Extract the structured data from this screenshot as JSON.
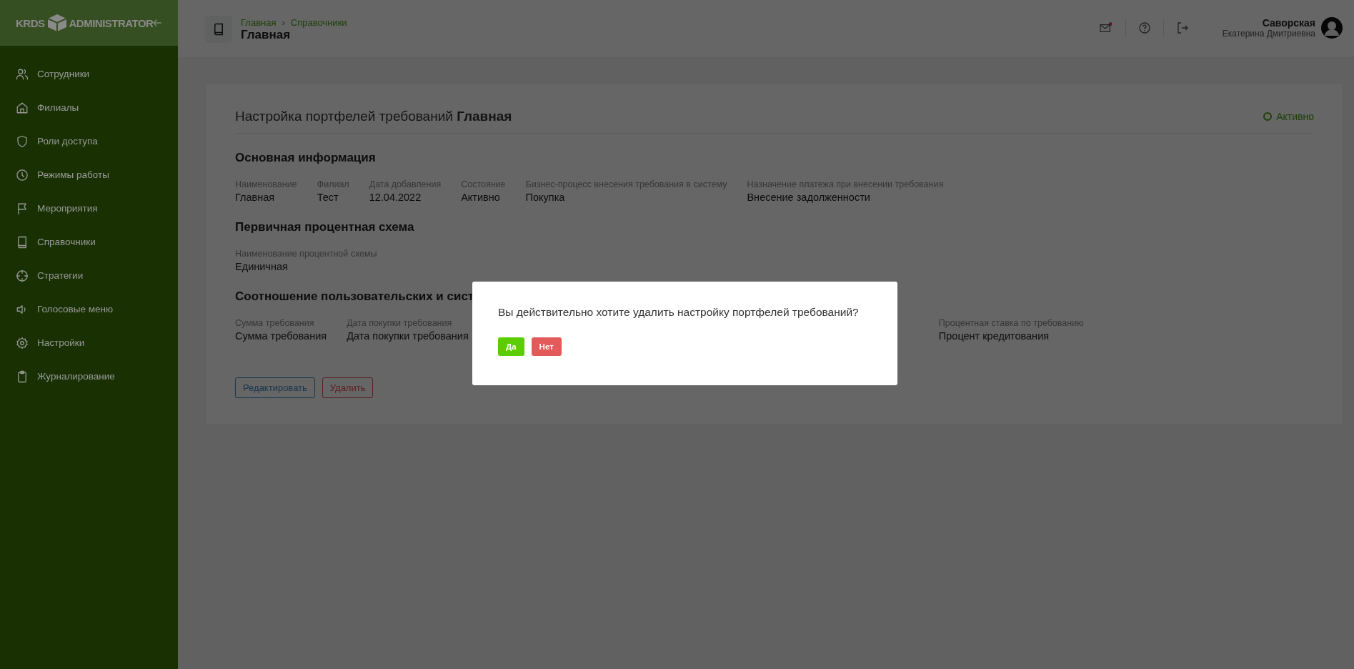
{
  "sidebar": {
    "logo_left": "KRDS",
    "logo_right": "ADMINISTRATOR",
    "items": [
      {
        "label": "Сотрудники"
      },
      {
        "label": "Филиалы"
      },
      {
        "label": "Роли доступа"
      },
      {
        "label": "Режимы работы"
      },
      {
        "label": "Мероприятия"
      },
      {
        "label": "Справочники"
      },
      {
        "label": "Стратегии"
      },
      {
        "label": "Голосовые меню"
      },
      {
        "label": "Настройки"
      },
      {
        "label": "Журналирование"
      }
    ]
  },
  "header": {
    "breadcrumbs": [
      "Главная",
      "Справочники"
    ],
    "breadcrumb_separator": "›",
    "title": "Главная",
    "unread_mail": true,
    "user": {
      "surname": "Саворская",
      "name": "Екатерина Дмитриевна"
    }
  },
  "card": {
    "title": "Настройка портфелей требований **Главная**",
    "status": {
      "label": "Активно",
      "active": true
    },
    "sections": [
      {
        "title": "Основная информация",
        "fields": [
          {
            "label": "Наименование",
            "value": "Главная"
          },
          {
            "label": "Филиал",
            "value": "Тест"
          },
          {
            "label": "Дата добавления",
            "value": "12.04.2022"
          },
          {
            "label": "Состояние",
            "value": "Активно"
          },
          {
            "label": "Бизнес-процесс внесения требования в систему",
            "value": "Покупка"
          },
          {
            "label": "Назначение платежа при внесении требования",
            "value": "Внесение задолженности"
          }
        ]
      },
      {
        "title": "Первичная процентная схема",
        "fields": [
          {
            "label": "Наименование процентной схемы",
            "value": "Единичная"
          }
        ]
      },
      {
        "title": "Соотношение пользовательских и сист",
        "fields": [
          {
            "label": "Сумма требования",
            "value": "Сумма требования"
          },
          {
            "label": "Дата покупки требования",
            "value": "Дата покупки требования"
          },
          {
            "label": "Процентная ставка по требованию",
            "value": "Процент кредитования"
          }
        ]
      }
    ],
    "buttons": [
      {
        "label": "Редактировать",
        "kind": "edit"
      },
      {
        "label": "Удалить",
        "kind": "delete"
      }
    ]
  },
  "dialog": {
    "message": "Вы действительно хотите удалить настройку портфелей требований?",
    "buttons": [
      {
        "label": "Да",
        "kind": "confirm"
      },
      {
        "label": "Нет",
        "kind": "cancel"
      }
    ]
  }
}
